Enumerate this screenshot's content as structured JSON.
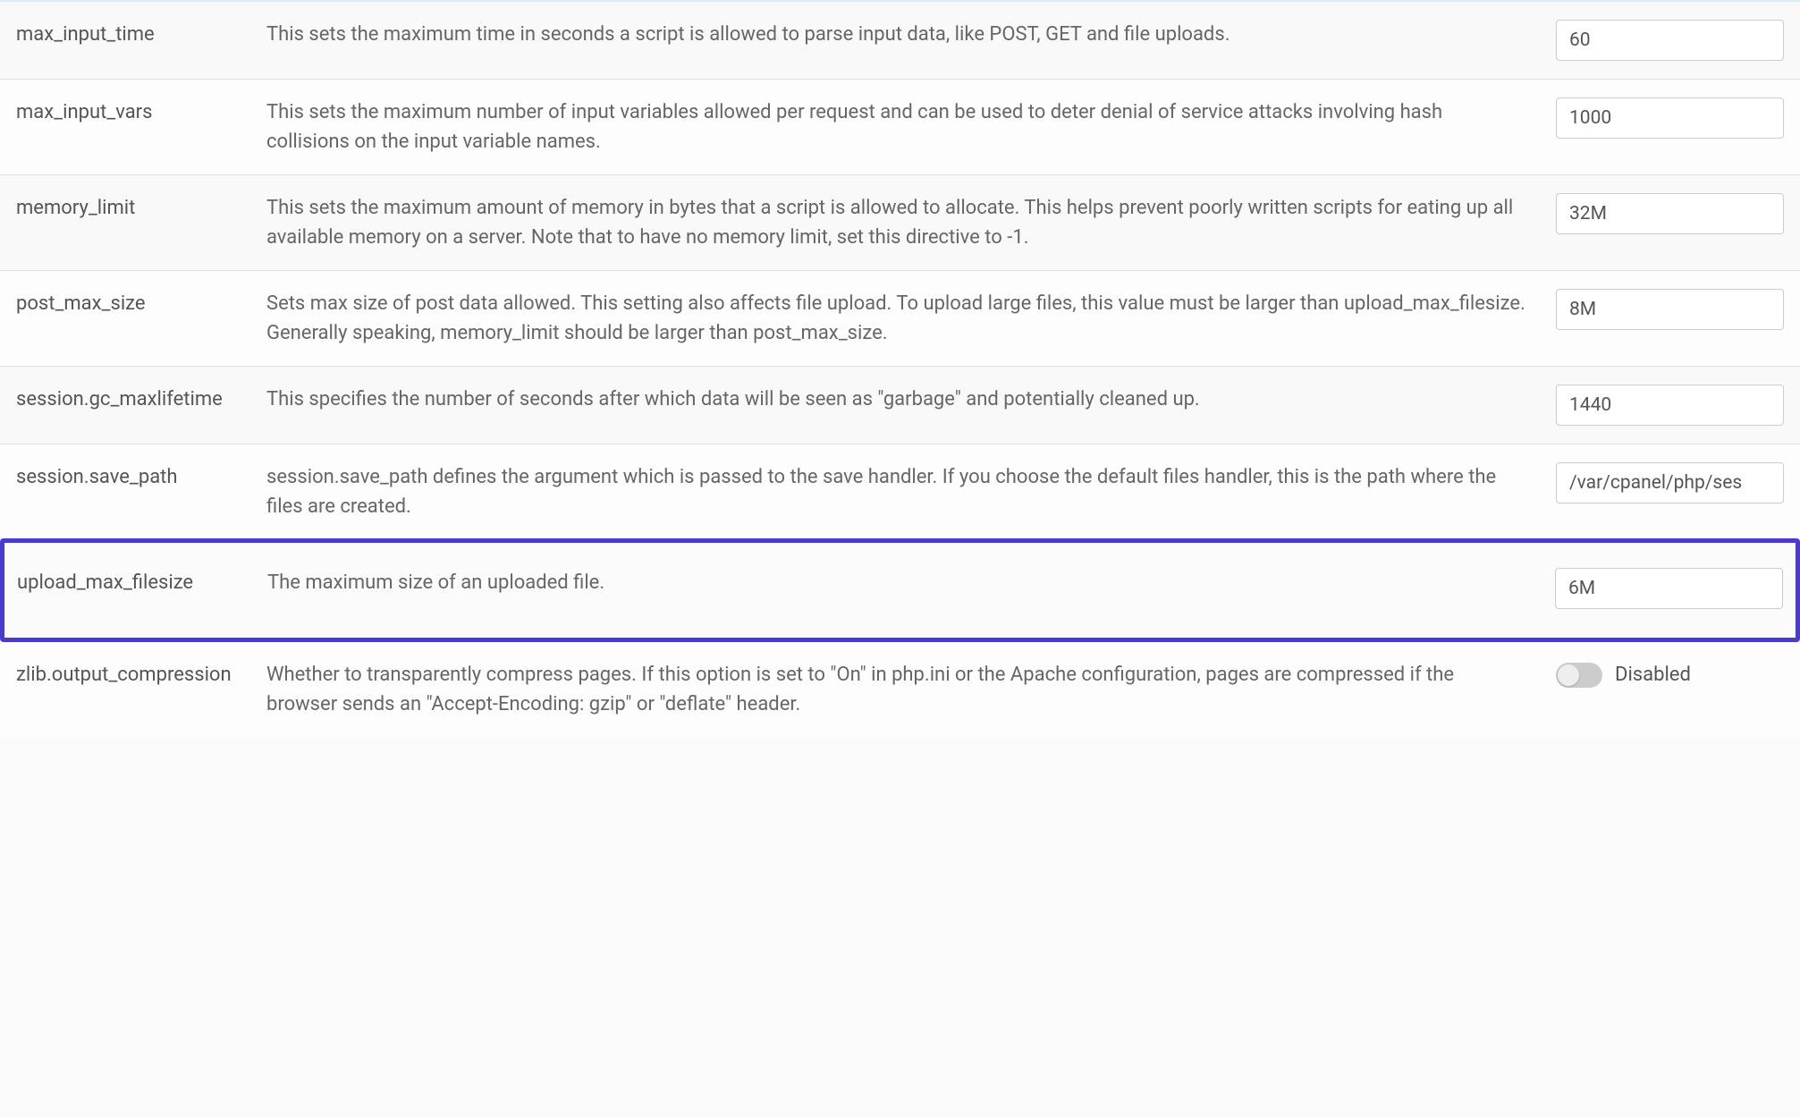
{
  "settings": [
    {
      "name": "max_input_time",
      "desc": "This sets the maximum time in seconds a script is allowed to parse input data, like POST, GET and file uploads.",
      "value": "60",
      "type": "text",
      "highlighted": false
    },
    {
      "name": "max_input_vars",
      "desc": "This sets the maximum number of input variables allowed per request and can be used to deter denial of service attacks involving hash collisions on the input variable names.",
      "value": "1000",
      "type": "text",
      "highlighted": false
    },
    {
      "name": "memory_limit",
      "desc": "This sets the maximum amount of memory in bytes that a script is allowed to allocate. This helps prevent poorly written scripts for eating up all available memory on a server. Note that to have no memory limit, set this directive to -1.",
      "value": "32M",
      "type": "text",
      "highlighted": false
    },
    {
      "name": "post_max_size",
      "desc": "Sets max size of post data allowed. This setting also affects file upload. To upload large files, this value must be larger than upload_max_filesize. Generally speaking, memory_limit should be larger than post_max_size.",
      "value": "8M",
      "type": "text",
      "highlighted": false
    },
    {
      "name": "session.gc_maxlifetime",
      "desc": "This specifies the number of seconds after which data will be seen as \"garbage\" and potentially cleaned up.",
      "value": "1440",
      "type": "text",
      "highlighted": false
    },
    {
      "name": "session.save_path",
      "desc": "session.save_path defines the argument which is passed to the save handler. If you choose the default files handler, this is the path where the files are created.",
      "value": "/var/cpanel/php/ses",
      "type": "text",
      "highlighted": false
    },
    {
      "name": "upload_max_filesize",
      "desc": "The maximum size of an uploaded file.",
      "value": "6M",
      "type": "text",
      "highlighted": true
    },
    {
      "name": "zlib.output_compression",
      "desc": "Whether to transparently compress pages. If this option is set to \"On\" in php.ini or the Apache configuration, pages are compressed if the browser sends an \"Accept-Encoding: gzip\" or \"deflate\" header.",
      "value": "Disabled",
      "type": "toggle",
      "highlighted": false
    }
  ]
}
